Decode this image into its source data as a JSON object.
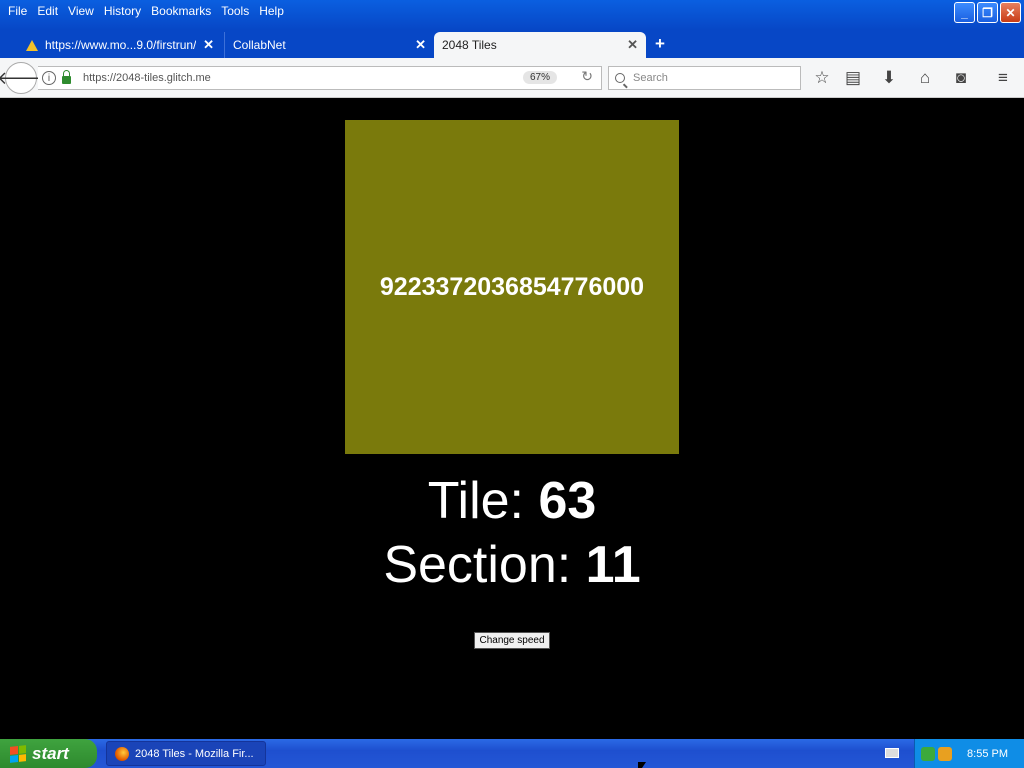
{
  "menubar": {
    "items": [
      "File",
      "Edit",
      "View",
      "History",
      "Bookmarks",
      "Tools",
      "Help"
    ]
  },
  "tabs": [
    {
      "label": "https://www.mo...9.0/firstrun/",
      "active": false,
      "icon": "warning-icon"
    },
    {
      "label": "CollabNet",
      "active": false
    },
    {
      "label": "2048 Tiles",
      "active": true
    }
  ],
  "navbar": {
    "url": "https://2048-tiles.glitch.me",
    "zoom": "67%",
    "search_placeholder": "Search"
  },
  "page": {
    "tile_value": "9223372036854776000",
    "tile_color": "#7a7a0c",
    "tile_label": "Tile:",
    "tile_number": "63",
    "section_label": "Section:",
    "section_number": "11",
    "speed_button": "Change speed"
  },
  "taskbar": {
    "start_label": "start",
    "task_label": "2048 Tiles - Mozilla Fir...",
    "clock": "8:55 PM"
  }
}
